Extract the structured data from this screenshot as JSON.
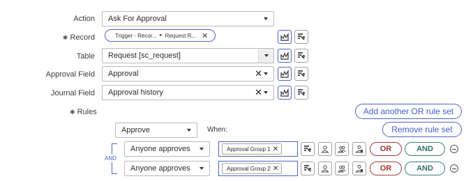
{
  "fields": {
    "action_label": "Action",
    "action_value": "Ask For Approval",
    "record_label": "Record",
    "record_required_mark": "✱",
    "record_pill_part1": "Trigger - Recor...",
    "record_pill_part2": "Request R...",
    "table_label": "Table",
    "table_value": "Request [sc_request]",
    "approval_field_label": "Approval Field",
    "approval_field_value": "Approval",
    "journal_field_label": "Journal Field",
    "journal_field_value": "Approval history"
  },
  "rules": {
    "label": "Rules",
    "required_mark": "✱",
    "add_or_rule_set": "Add another OR rule set",
    "remove_rule_set": "Remove rule set",
    "decision": "Approve",
    "when_label": "When:",
    "and_label": "AND",
    "rows": [
      {
        "condition": "Anyone approves",
        "group": "Approval Group 1",
        "or_label": "OR",
        "and_label": "AND"
      },
      {
        "condition": "Anyone approves",
        "group": "Approval Group 2",
        "or_label": "OR",
        "and_label": "AND"
      }
    ]
  },
  "icons": {
    "data_pill_picker": "data-pill-picker-icon",
    "script_toggle": "script-toggle-icon",
    "user": "user-icon",
    "group": "group-icon",
    "manual_user": "manual-user-icon",
    "remove": "remove-row-icon"
  },
  "colors": {
    "accent_blue": "#4a66c5",
    "or_red": "#a63b3b",
    "and_teal": "#3b7f7b"
  }
}
